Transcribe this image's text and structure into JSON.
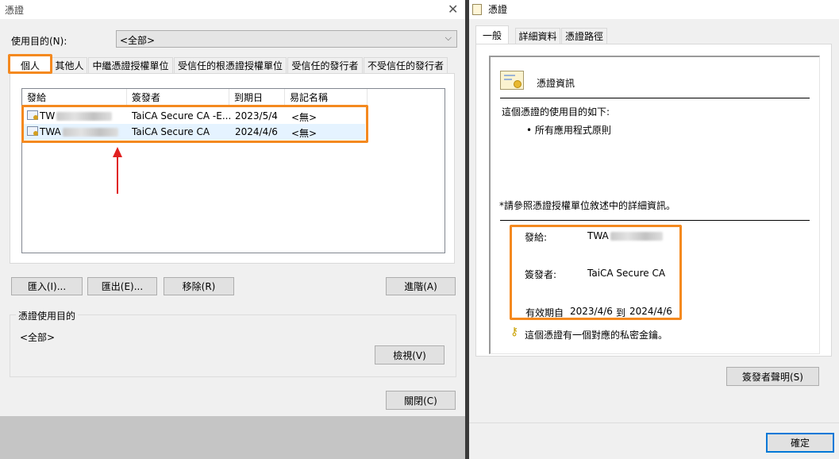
{
  "left": {
    "title": "憑證",
    "purpose_label": "使用目的(N):",
    "purpose_value": "<全部>",
    "tabs": [
      "個人",
      "其他人",
      "中繼憑證授權單位",
      "受信任的根憑證授權單位",
      "受信任的發行者",
      "不受信任的發行者"
    ],
    "columns": [
      "發給",
      "簽發者",
      "到期日",
      "易記名稱"
    ],
    "rows": [
      {
        "issued_to": "TW",
        "issuer": "TaiCA Secure CA -E...",
        "expires": "2023/5/4",
        "friendly": "<無>"
      },
      {
        "issued_to": "TWA",
        "issuer": "TaiCA Secure CA",
        "expires": "2024/4/6",
        "friendly": "<無>"
      }
    ],
    "buttons": {
      "import": "匯入(I)...",
      "export": "匯出(E)...",
      "remove": "移除(R)",
      "advanced": "進階(A)",
      "view": "檢視(V)",
      "close": "關閉(C)"
    },
    "group_title": "憑證使用目的",
    "group_value": "<全部>"
  },
  "right": {
    "title": "憑證",
    "tabs": [
      "一般",
      "詳細資料",
      "憑證路徑"
    ],
    "heading": "憑證資訊",
    "purpose_intro": "這個憑證的使用目的如下:",
    "purpose_item": "• 所有應用程式原則",
    "note": "*請參照憑證授權單位敘述中的詳細資訊。",
    "issued_to_label": "發給:",
    "issued_to_value": "TWA",
    "issuer_label": "簽發者:",
    "issuer_value": "TaiCA Secure CA",
    "validity_label": "有效期自",
    "valid_from": "2023/4/6",
    "validity_to_word": "到",
    "valid_to": "2024/4/6",
    "private_key_text": "這個憑證有一個對應的私密金鑰。",
    "issuer_statement_btn": "簽發者聲明(S)",
    "ok_btn": "確定"
  },
  "colors": {
    "highlight": "#f4891f",
    "arrow": "#e02020",
    "accent": "#0078d7"
  }
}
